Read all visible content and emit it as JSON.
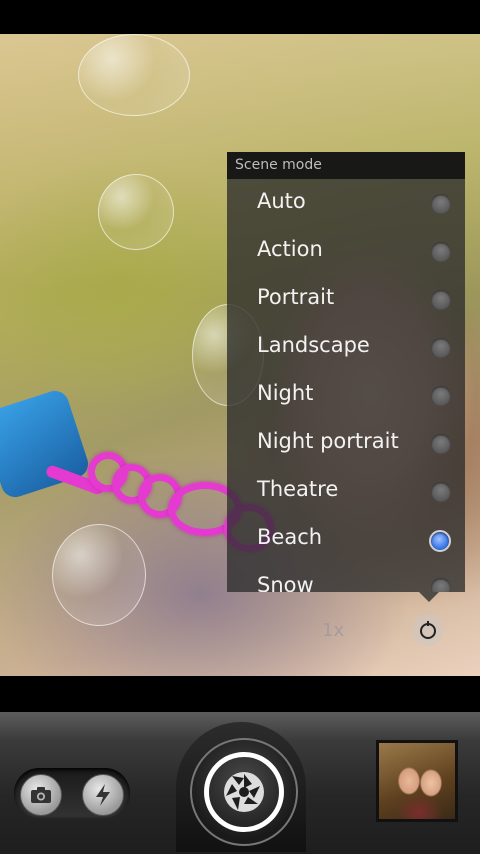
{
  "scene_mode": {
    "header": "Scene mode",
    "options": [
      {
        "label": "Auto",
        "selected": false
      },
      {
        "label": "Action",
        "selected": false
      },
      {
        "label": "Portrait",
        "selected": false
      },
      {
        "label": "Landscape",
        "selected": false
      },
      {
        "label": "Night",
        "selected": false
      },
      {
        "label": "Night portrait",
        "selected": false
      },
      {
        "label": "Theatre",
        "selected": false
      },
      {
        "label": "Beach",
        "selected": true
      },
      {
        "label": "Snow",
        "selected": false
      }
    ]
  },
  "viewfinder": {
    "zoom_label": "1x"
  },
  "controls": {
    "camera_mode_icon": "camera-icon",
    "flash_icon": "flash-icon",
    "shutter_icon": "aperture-icon",
    "gallery_thumbnail": "gallery-thumbnail"
  },
  "colors": {
    "selected_radio": "#3b78e7",
    "panel_bg": "#2d2d2d"
  }
}
